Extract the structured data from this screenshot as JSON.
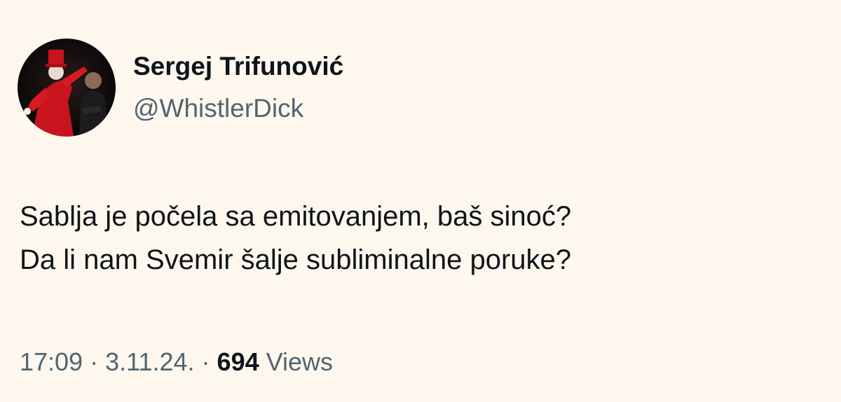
{
  "tweet": {
    "display_name": "Sergej Trifunović",
    "handle": "@WhistlerDick",
    "text_lines": [
      "Sablja je počela sa emitovanjem, baš sinoć?",
      "Da li nam Svemir šalje subliminalne poruke?"
    ],
    "time": "17:09",
    "date": "3.11.24.",
    "separator": " · ",
    "views_count": "694",
    "views_label": "Views"
  },
  "colors": {
    "background": "#fdf7ee",
    "text_primary": "#0f1419",
    "text_secondary": "#536471"
  }
}
